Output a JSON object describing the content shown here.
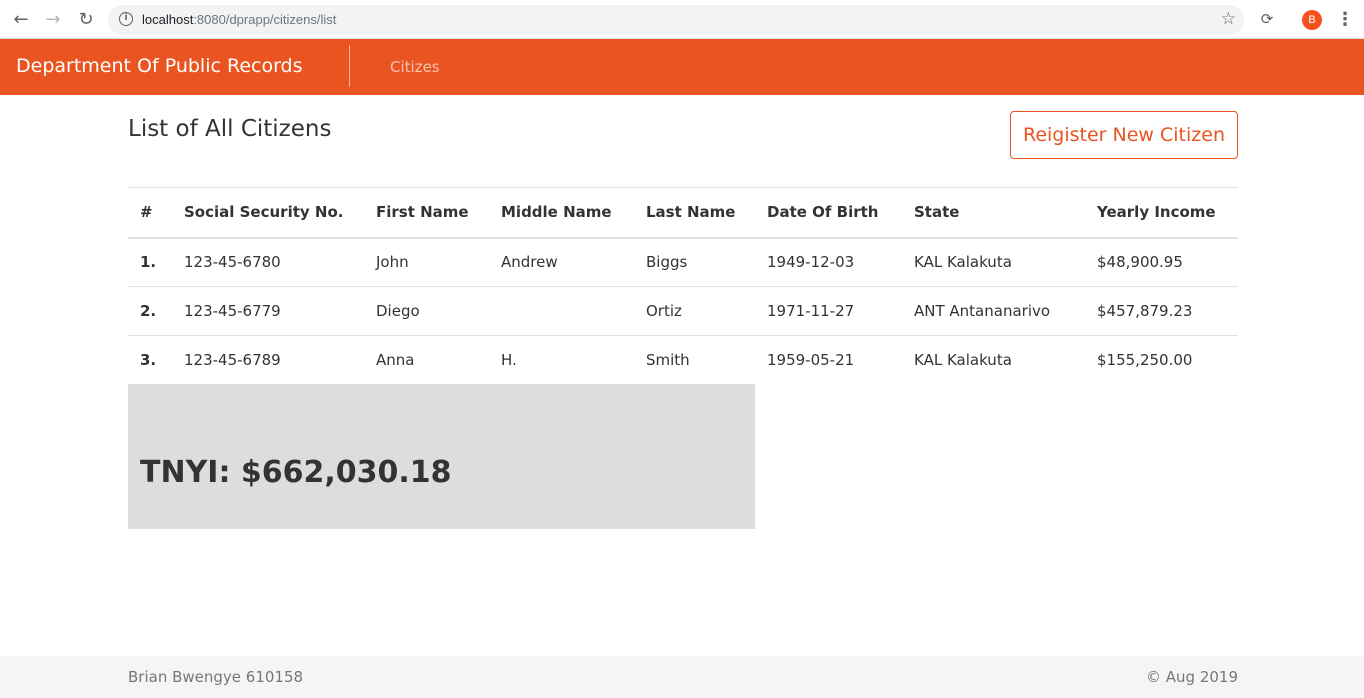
{
  "browser": {
    "url_host": "localhost",
    "url_rest": ":8080/dprapp/citizens/list",
    "profile_initial": "B"
  },
  "navbar": {
    "brand": "Department Of Public Records",
    "link": "Citizes",
    "accent_color": "#e95420"
  },
  "main": {
    "title": "List of All Citizens",
    "register_button": "Reigister New Citizen",
    "table": {
      "headers": [
        "#",
        "Social Security No.",
        "First Name",
        "Middle Name",
        "Last Name",
        "Date Of Birth",
        "State",
        "Yearly Income"
      ],
      "rows": [
        [
          "1.",
          "123-45-6780",
          "John",
          "Andrew",
          "Biggs",
          "1949-12-03",
          "KAL Kalakuta",
          "$48,900.95"
        ],
        [
          "2.",
          "123-45-6779",
          "Diego",
          "",
          "Ortiz",
          "1971-11-27",
          "ANT Antananarivo",
          "$457,879.23"
        ],
        [
          "3.",
          "123-45-6789",
          "Anna",
          "H.",
          "Smith",
          "1959-05-21",
          "KAL Kalakuta",
          "$155,250.00"
        ]
      ]
    },
    "total": "TNYI: $662,030.18"
  },
  "footer": {
    "left": "Brian Bwengye 610158",
    "right": "© Aug 2019"
  }
}
